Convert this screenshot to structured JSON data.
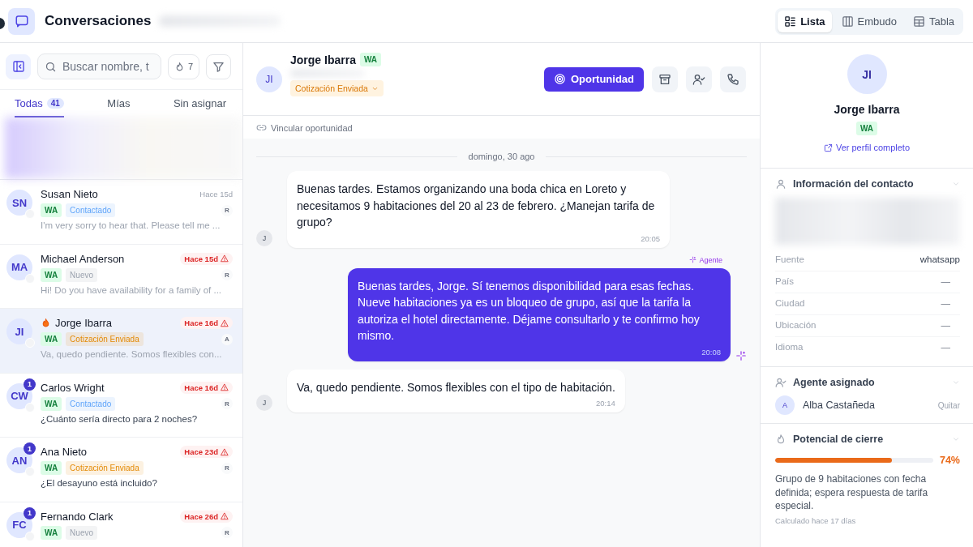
{
  "header": {
    "title": "Conversaciones",
    "views": [
      {
        "label": "Lista",
        "selected": true
      },
      {
        "label": "Embudo",
        "selected": false
      },
      {
        "label": "Tabla",
        "selected": false
      }
    ]
  },
  "sidebar": {
    "search": {
      "placeholder": "Buscar nombre, t"
    },
    "hot_count": "7",
    "tabs": [
      {
        "label": "Todas",
        "count": "41",
        "selected": true
      },
      {
        "label": "Mías",
        "selected": false
      },
      {
        "label": "Sin asignar",
        "selected": false
      }
    ],
    "conversations": [
      {
        "initials": "SN",
        "name": "Susan Nieto",
        "time": "Hace 15d",
        "overdue": false,
        "hot": false,
        "channel": "WA",
        "status": {
          "label": "Contactado",
          "color": "#60a5fa"
        },
        "agent": "R",
        "preview": "I'm very sorry to hear that. Please tell me ...",
        "unread_preview": false,
        "selected": false
      },
      {
        "initials": "MA",
        "name": "Michael Anderson",
        "time": "Hace 15d",
        "overdue": true,
        "hot": false,
        "channel": "WA",
        "status": {
          "label": "Nuevo",
          "color": "#9ca3af"
        },
        "agent": "R",
        "preview": "Hi! Do you have availability for a family of ...",
        "unread_preview": false,
        "selected": false
      },
      {
        "initials": "JI",
        "name": "Jorge Ibarra",
        "time": "Hace 16d",
        "overdue": true,
        "hot": true,
        "channel": "WA",
        "status": {
          "label": "Cotización Enviada",
          "color": "#e38a06"
        },
        "agent": "A",
        "preview": "Va, quedo pendiente. Somos flexibles con...",
        "unread_preview": false,
        "selected": true
      },
      {
        "initials": "CW",
        "name": "Carlos Wright",
        "time": "Hace 16d",
        "overdue": true,
        "hot": false,
        "unread": "1",
        "channel": "WA",
        "status": {
          "label": "Contactado",
          "color": "#60a5fa"
        },
        "agent": "R",
        "preview": "¿Cuánto sería directo para 2 noches?",
        "unread_preview": true,
        "selected": false
      },
      {
        "initials": "AN",
        "name": "Ana Nieto",
        "time": "Hace 23d",
        "overdue": true,
        "hot": false,
        "unread": "1",
        "channel": "WA",
        "status": {
          "label": "Cotización Enviada",
          "color": "#e38a06"
        },
        "agent": "R",
        "preview": "¿El desayuno está incluido?",
        "unread_preview": true,
        "selected": false
      },
      {
        "initials": "FC",
        "name": "Fernando Clark",
        "time": "Hace 26d",
        "overdue": true,
        "hot": false,
        "unread": "1",
        "channel": "WA",
        "status": {
          "label": "Nuevo",
          "color": "#9ca3af"
        },
        "agent": "R",
        "selected": false
      }
    ]
  },
  "chat": {
    "contact": {
      "initials": "JI",
      "name": "Jorge Ibarra",
      "channel": "WA",
      "status": "Cotización Enviada"
    },
    "opportunity_button": "Oportunidad",
    "link_opportunity": "Vincular oportunidad",
    "date_divider": "domingo, 30 ago",
    "messages": [
      {
        "kind": "incoming",
        "avatar": "J",
        "text": "Buenas tardes. Estamos organizando una boda chica en Loreto y necesitamos 9 habitaciones del 20 al 23 de febrero. ¿Manejan tarifa de grupo?",
        "time": "20:05"
      },
      {
        "kind": "outgoing",
        "sender": "Agente",
        "text": "Buenas tardes, Jorge. Sí tenemos disponibilidad para esas fechas. Nueve habitaciones ya es un bloqueo de grupo, así que la tarifa la autoriza el hotel directamente. Déjame consultarlo y te confirmo hoy mismo.",
        "time": "20:08"
      },
      {
        "kind": "incoming",
        "avatar": "J",
        "text": "Va, quedo pendiente. Somos flexibles con el tipo de habitación.",
        "time": "20:14"
      }
    ]
  },
  "profile": {
    "initials": "JI",
    "name": "Jorge Ibarra",
    "channel": "WA",
    "profile_link": "Ver perfil completo",
    "contact_section": {
      "title": "Información del contacto",
      "fields": [
        {
          "label": "Fuente",
          "value": "whatsapp"
        },
        {
          "label": "País",
          "value": "—"
        },
        {
          "label": "Ciudad",
          "value": "—"
        },
        {
          "label": "Ubicación",
          "value": "—"
        },
        {
          "label": "Idioma",
          "value": "—"
        }
      ]
    },
    "agent_section": {
      "title": "Agente asignado",
      "agent_initial": "A",
      "agent_name": "Alba Castañeda",
      "remove": "Quitar"
    },
    "potential_section": {
      "title": "Potencial de cierre",
      "level": 0.74,
      "reading": "74%",
      "summary": "Grupo de 9 habitaciones con fecha definida; espera respuesta de tarifa especial.",
      "calculated": "Calculado hace 17 días"
    }
  }
}
